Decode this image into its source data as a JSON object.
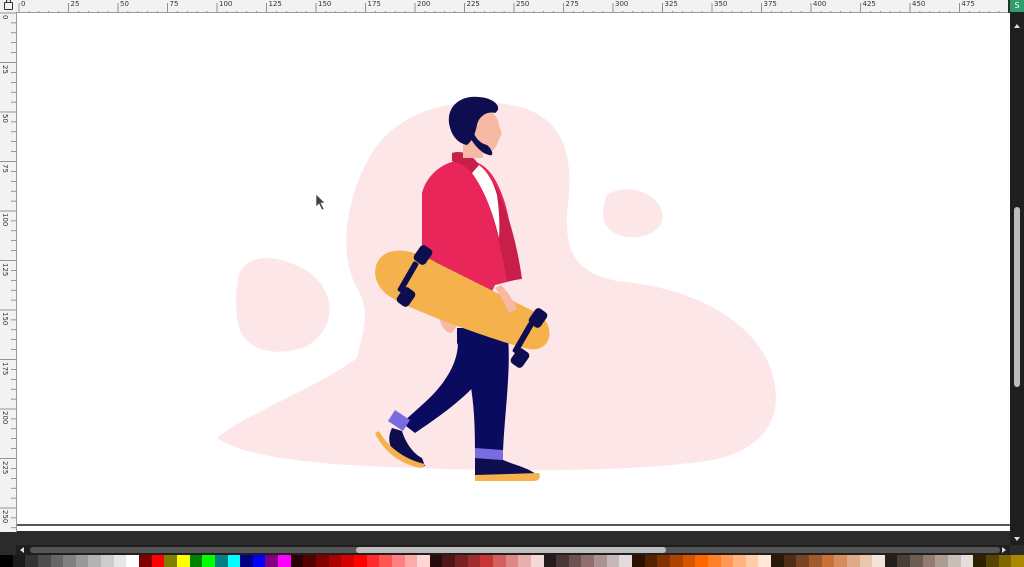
{
  "ruler": {
    "labels": [
      "0",
      "25",
      "50",
      "75",
      "100",
      "125",
      "150",
      "175",
      "200",
      "225",
      "250",
      "275",
      "300",
      "325",
      "350",
      "375",
      "400",
      "425",
      "450",
      "475"
    ]
  },
  "vertical_ruler": {
    "labels": [
      "0",
      "25",
      "50",
      "75",
      "100",
      "125",
      "150",
      "175",
      "200",
      "225",
      "250"
    ]
  },
  "status": {
    "snap_label": "S"
  },
  "illustration": {
    "subject": "man-walking-with-skateboard",
    "colors": {
      "blob": "#fce6e8",
      "jacket": "#e8265a",
      "jacket_dark": "#c81e4a",
      "skin": "#f7b8a4",
      "hair": "#0d0d4f",
      "pants": "#0a0a5e",
      "board": "#f5b24c",
      "wheels": "#0d0d4f",
      "cuff": "#7a6ce0",
      "sole": "#f5b24c",
      "shirt": "#ffffff"
    }
  },
  "palette": [
    "#000000",
    "#1a1a1a",
    "#333333",
    "#4d4d4d",
    "#666666",
    "#808080",
    "#999999",
    "#b3b3b3",
    "#cccccc",
    "#e6e6e6",
    "#ffffff",
    "#800000",
    "#ff0000",
    "#808000",
    "#ffff00",
    "#008000",
    "#00ff00",
    "#008080",
    "#00ffff",
    "#000080",
    "#0000ff",
    "#800080",
    "#ff00ff",
    "#2b0000",
    "#550000",
    "#800000",
    "#aa0000",
    "#d40000",
    "#ff0000",
    "#ff2a2a",
    "#ff5555",
    "#ff8080",
    "#ffaaaa",
    "#ffd5d5",
    "#280b0b",
    "#501616",
    "#782121",
    "#a02c2c",
    "#c83737",
    "#d35f5f",
    "#de8787",
    "#e9afaf",
    "#f4d7d7",
    "#241c1c",
    "#483737",
    "#6c5353",
    "#916f6f",
    "#ac9393",
    "#c8b7b7",
    "#e3dbdb",
    "#2b1100",
    "#552200",
    "#803300",
    "#aa4400",
    "#d45500",
    "#ff6600",
    "#ff7f2a",
    "#ff9955",
    "#ffb380",
    "#ffccaa",
    "#ffe6d5",
    "#28170b",
    "#502d16",
    "#784421",
    "#a05a2c",
    "#c87137",
    "#d38d5f",
    "#deaa87",
    "#e9c6af",
    "#f4e3d7",
    "#241f1c",
    "#483e37",
    "#6c5d53",
    "#917c6f",
    "#ac9d93",
    "#c8beb7",
    "#e3dedb",
    "#2b2200",
    "#554400",
    "#806600",
    "#aa8800"
  ]
}
